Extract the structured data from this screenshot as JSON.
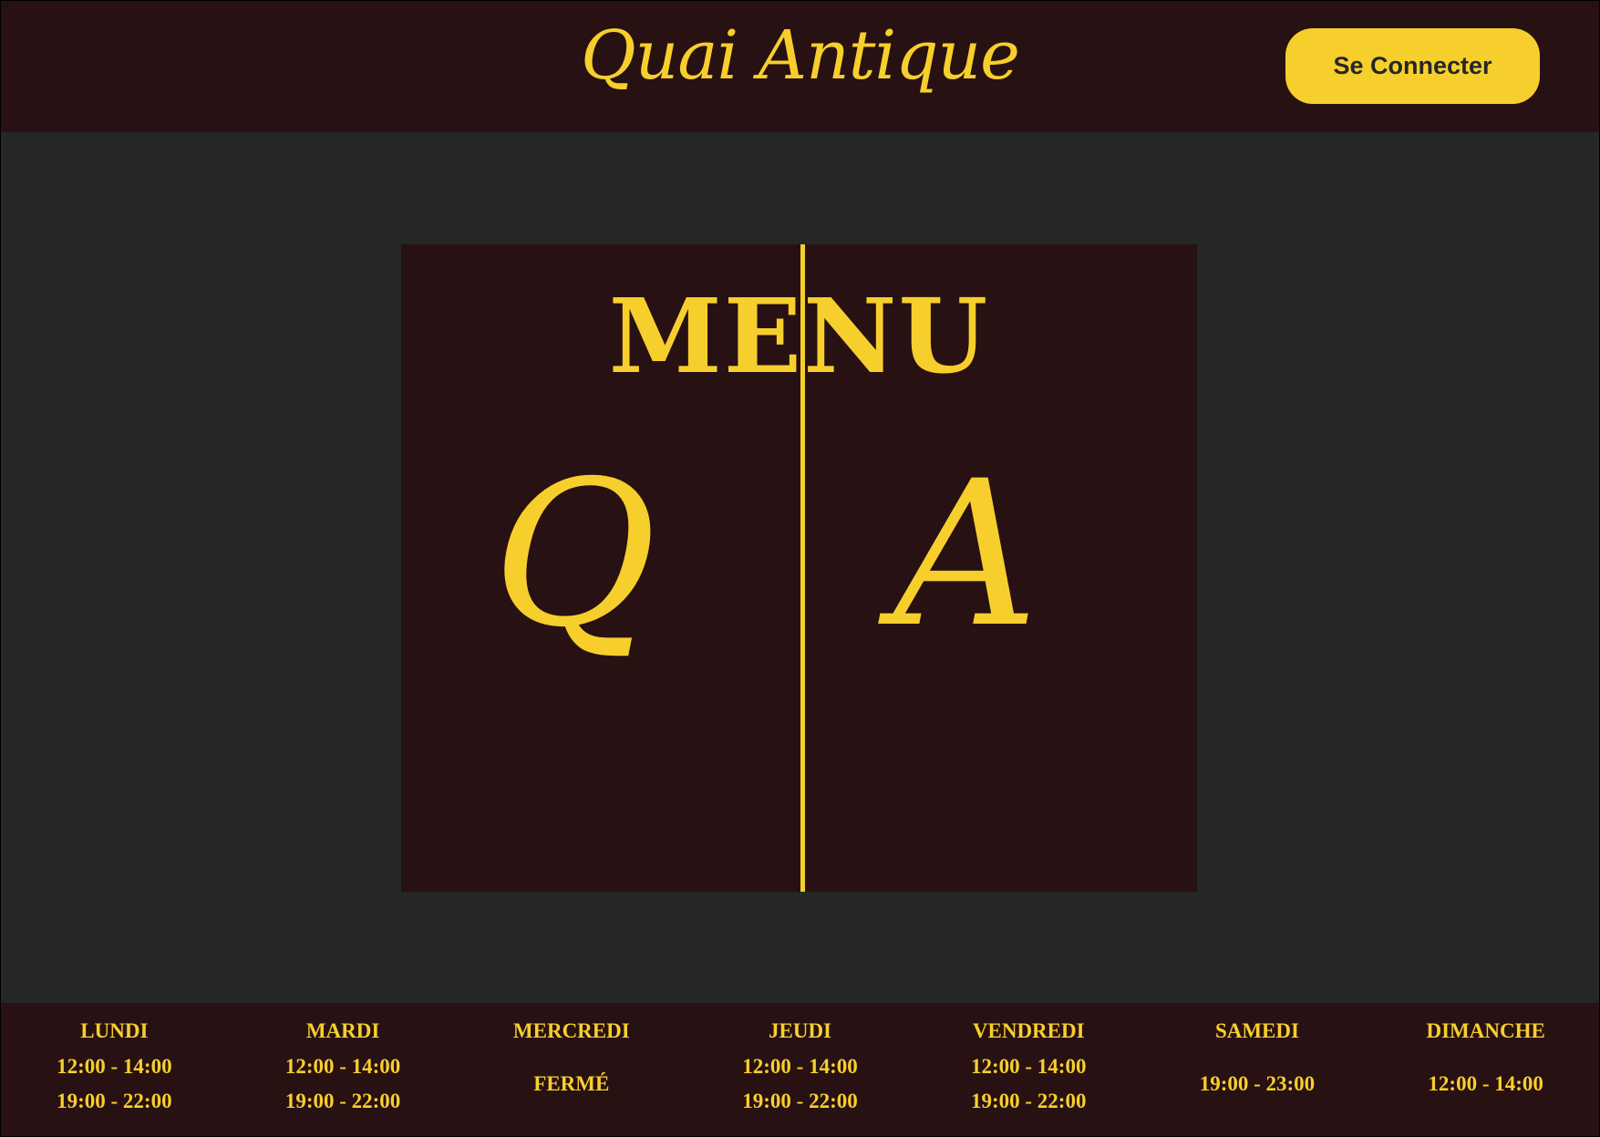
{
  "header": {
    "brand": "Quai Antique",
    "login_label": "Se Connecter"
  },
  "menu": {
    "title": "MENU",
    "monogram_left": "Q",
    "monogram_right": "A"
  },
  "hours": [
    {
      "day": "LUNDI",
      "slots": [
        "12:00 - 14:00",
        "19:00 - 22:00"
      ]
    },
    {
      "day": "MARDI",
      "slots": [
        "12:00 - 14:00",
        "19:00 - 22:00"
      ]
    },
    {
      "day": "MERCREDI",
      "slots": [
        "FERMÉ"
      ]
    },
    {
      "day": "JEUDI",
      "slots": [
        "12:00 - 14:00",
        "19:00 - 22:00"
      ]
    },
    {
      "day": "VENDREDI",
      "slots": [
        "12:00 - 14:00",
        "19:00 - 22:00"
      ]
    },
    {
      "day": "SAMEDI",
      "slots": [
        "19:00 - 23:00"
      ]
    },
    {
      "day": "DIMANCHE",
      "slots": [
        "12:00 - 14:00"
      ]
    }
  ],
  "colors": {
    "accent": "#f7cf2d",
    "dark_brown": "#281112",
    "background": "#252726"
  }
}
